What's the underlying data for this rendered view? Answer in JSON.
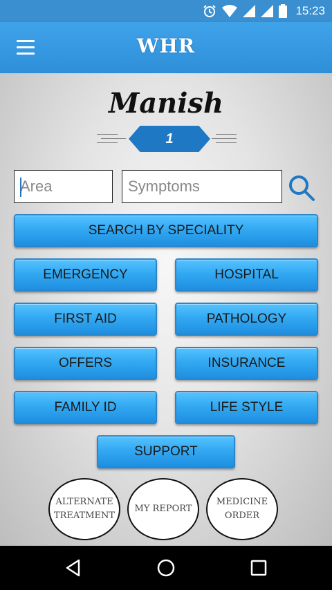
{
  "status_bar": {
    "time": "15:23"
  },
  "app_bar": {
    "title": "WHR"
  },
  "profile": {
    "name": "Manish",
    "level": "1"
  },
  "search": {
    "area_placeholder": "Area",
    "symptoms_placeholder": "Symptoms"
  },
  "buttons": {
    "speciality": "SEARCH BY SPECIALITY",
    "emergency": "EMERGENCY",
    "hospital": "HOSPITAL",
    "first_aid": "FIRST AID",
    "pathology": "PATHOLOGY",
    "offers": "OFFERS",
    "insurance": "INSURANCE",
    "family_id": "FAMILY ID",
    "life_style": "LIFE STYLE",
    "support": "SUPPORT"
  },
  "circles": {
    "alternate_line1": "ALTERNATE",
    "alternate_line2": "TREATMENT",
    "my_report": "MY REPORT",
    "medicine_line1": "MEDICINE",
    "medicine_line2": "ORDER"
  },
  "colors": {
    "primary": "#2e8fd9",
    "button": "#33a9f2",
    "badge": "#1f78c4"
  }
}
